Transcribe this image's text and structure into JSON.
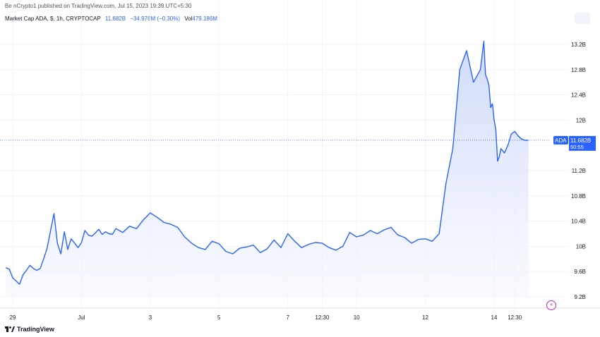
{
  "header": {
    "publisher_text": "BeInCrypto1 published on TradingView.com, Jul 15, 2023 19:39 UTC+5:30",
    "symbol": "Market Cap ADA, $, 1h, CRYPTOCAP",
    "last_value": "11.682B",
    "change": "−34.976M (−0.30%)",
    "volume_label": "Vol",
    "volume_value": "479.186M"
  },
  "price_tag": {
    "symbol": "ADA",
    "value": "11.682B",
    "countdown": "50:55"
  },
  "footer": {
    "brand": "TradingView"
  },
  "colors": {
    "line": "#2962ff",
    "area_top": "#c7d4fb",
    "area_bottom": "#f5f7fe",
    "tag_bg": "#2962ff",
    "grid": "#f0f3fa"
  },
  "chart_data": {
    "type": "area",
    "ylim": [
      9.1,
      13.45
    ],
    "y_ticks": [
      {
        "label": "13.2B",
        "value": 13.2
      },
      {
        "label": "12.8B",
        "value": 12.8
      },
      {
        "label": "12.4B",
        "value": 12.4
      },
      {
        "label": "12B",
        "value": 12.0
      },
      {
        "label": "11.6B",
        "value": 11.6
      },
      {
        "label": "11.2B",
        "value": 11.2
      },
      {
        "label": "10.8B",
        "value": 10.8
      },
      {
        "label": "10.4B",
        "value": 10.4
      },
      {
        "label": "10B",
        "value": 10.0
      },
      {
        "label": "9.6B",
        "value": 9.6
      },
      {
        "label": "9.2B",
        "value": 9.2
      }
    ],
    "x_ticks": [
      {
        "label": "29",
        "x": 0
      },
      {
        "label": "Jul",
        "x": 2
      },
      {
        "label": "3",
        "x": 4
      },
      {
        "label": "5",
        "x": 6
      },
      {
        "label": "7",
        "x": 8
      },
      {
        "label": "12:30",
        "x": 9
      },
      {
        "label": "10",
        "x": 10
      },
      {
        "label": "12",
        "x": 12
      },
      {
        "label": "14",
        "x": 14
      },
      {
        "label": "12:30",
        "x": 14.6
      }
    ],
    "xlim": [
      -0.1,
      15
    ],
    "current_value": 11.682,
    "series": [
      {
        "x": [
          -0.2,
          -0.1,
          0.0,
          0.1,
          0.2,
          0.3,
          0.4,
          0.5,
          0.6,
          0.7,
          0.8,
          0.9,
          1.0,
          1.1,
          1.2,
          1.3,
          1.4,
          1.5,
          1.55,
          1.6,
          1.7,
          1.8,
          1.9,
          2.0,
          2.1,
          2.2,
          2.3,
          2.4,
          2.5,
          2.6,
          2.7,
          2.8,
          2.9,
          3.0,
          3.2,
          3.4,
          3.6,
          3.8,
          4.0,
          4.2,
          4.4,
          4.6,
          4.8,
          5.0,
          5.2,
          5.4,
          5.6,
          5.8,
          6.0,
          6.2,
          6.4,
          6.6,
          6.8,
          7.0,
          7.2,
          7.4,
          7.6,
          7.8,
          8.0,
          8.2,
          8.4,
          8.6,
          8.8,
          9.0,
          9.2,
          9.4,
          9.6,
          9.8,
          10.0,
          10.2,
          10.4,
          10.6,
          10.8,
          11.0,
          11.2,
          11.4,
          11.6,
          11.8,
          12.0,
          12.2,
          12.4,
          12.6,
          12.8,
          13.0,
          13.2,
          13.4,
          13.6,
          13.7,
          13.75,
          13.8,
          13.85,
          13.9,
          13.95,
          14.0,
          14.05,
          14.1,
          14.15,
          14.2,
          14.3,
          14.4,
          14.5,
          14.6,
          14.7,
          14.8,
          14.9,
          15.0
        ],
        "values": [
          9.66,
          9.64,
          9.5,
          9.45,
          9.4,
          9.55,
          9.62,
          9.7,
          9.65,
          9.62,
          9.65,
          9.8,
          9.97,
          10.25,
          10.52,
          10.05,
          9.88,
          10.23,
          10.1,
          9.95,
          10.12,
          10.05,
          9.98,
          10.06,
          10.25,
          10.18,
          10.16,
          10.21,
          10.27,
          10.19,
          10.23,
          10.2,
          10.19,
          10.28,
          10.22,
          10.32,
          10.28,
          10.42,
          10.53,
          10.46,
          10.38,
          10.35,
          10.3,
          10.15,
          10.05,
          9.98,
          9.95,
          10.08,
          10.04,
          9.92,
          9.88,
          9.97,
          9.99,
          10.02,
          9.9,
          9.96,
          10.1,
          9.98,
          10.2,
          10.08,
          9.98,
          10.03,
          10.06,
          10.05,
          9.98,
          9.94,
          10.0,
          10.22,
          10.15,
          10.18,
          10.25,
          10.2,
          10.26,
          10.3,
          10.18,
          10.14,
          10.05,
          10.11,
          10.12,
          10.08,
          10.2,
          11.0,
          11.55,
          12.8,
          13.1,
          12.6,
          12.8,
          13.25,
          12.72,
          12.65,
          12.55,
          12.2,
          12.26,
          12.0,
          11.85,
          11.35,
          11.42,
          11.55,
          11.48,
          11.6,
          11.78,
          11.82,
          11.75,
          11.7,
          11.68,
          11.682
        ]
      }
    ]
  }
}
